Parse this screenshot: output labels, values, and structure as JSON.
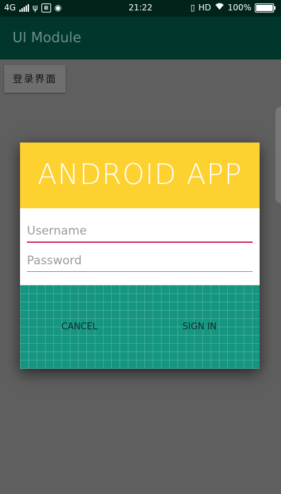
{
  "status_bar": {
    "network": "4G",
    "time": "21:22",
    "hd_label": "HD",
    "battery": "100%",
    "battery_level": 1.0
  },
  "app_bar": {
    "title": "UI Module"
  },
  "page_button": {
    "label": "登录界面"
  },
  "dialog": {
    "title": "ANDROID APP",
    "username_placeholder": "Username",
    "password_placeholder": "Password",
    "cancel_label": "CANCEL",
    "sign_in_label": "SIGN IN"
  },
  "colors": {
    "header_yellow": "#fdd12f",
    "footer_teal": "#159680",
    "accent_pink": "#d6245f",
    "app_bar": "#00362c"
  },
  "icons": [
    "signal-icon",
    "usb-icon",
    "notification-box-icon",
    "weibo-icon",
    "vibrate-icon",
    "wifi-icon",
    "battery-icon"
  ]
}
